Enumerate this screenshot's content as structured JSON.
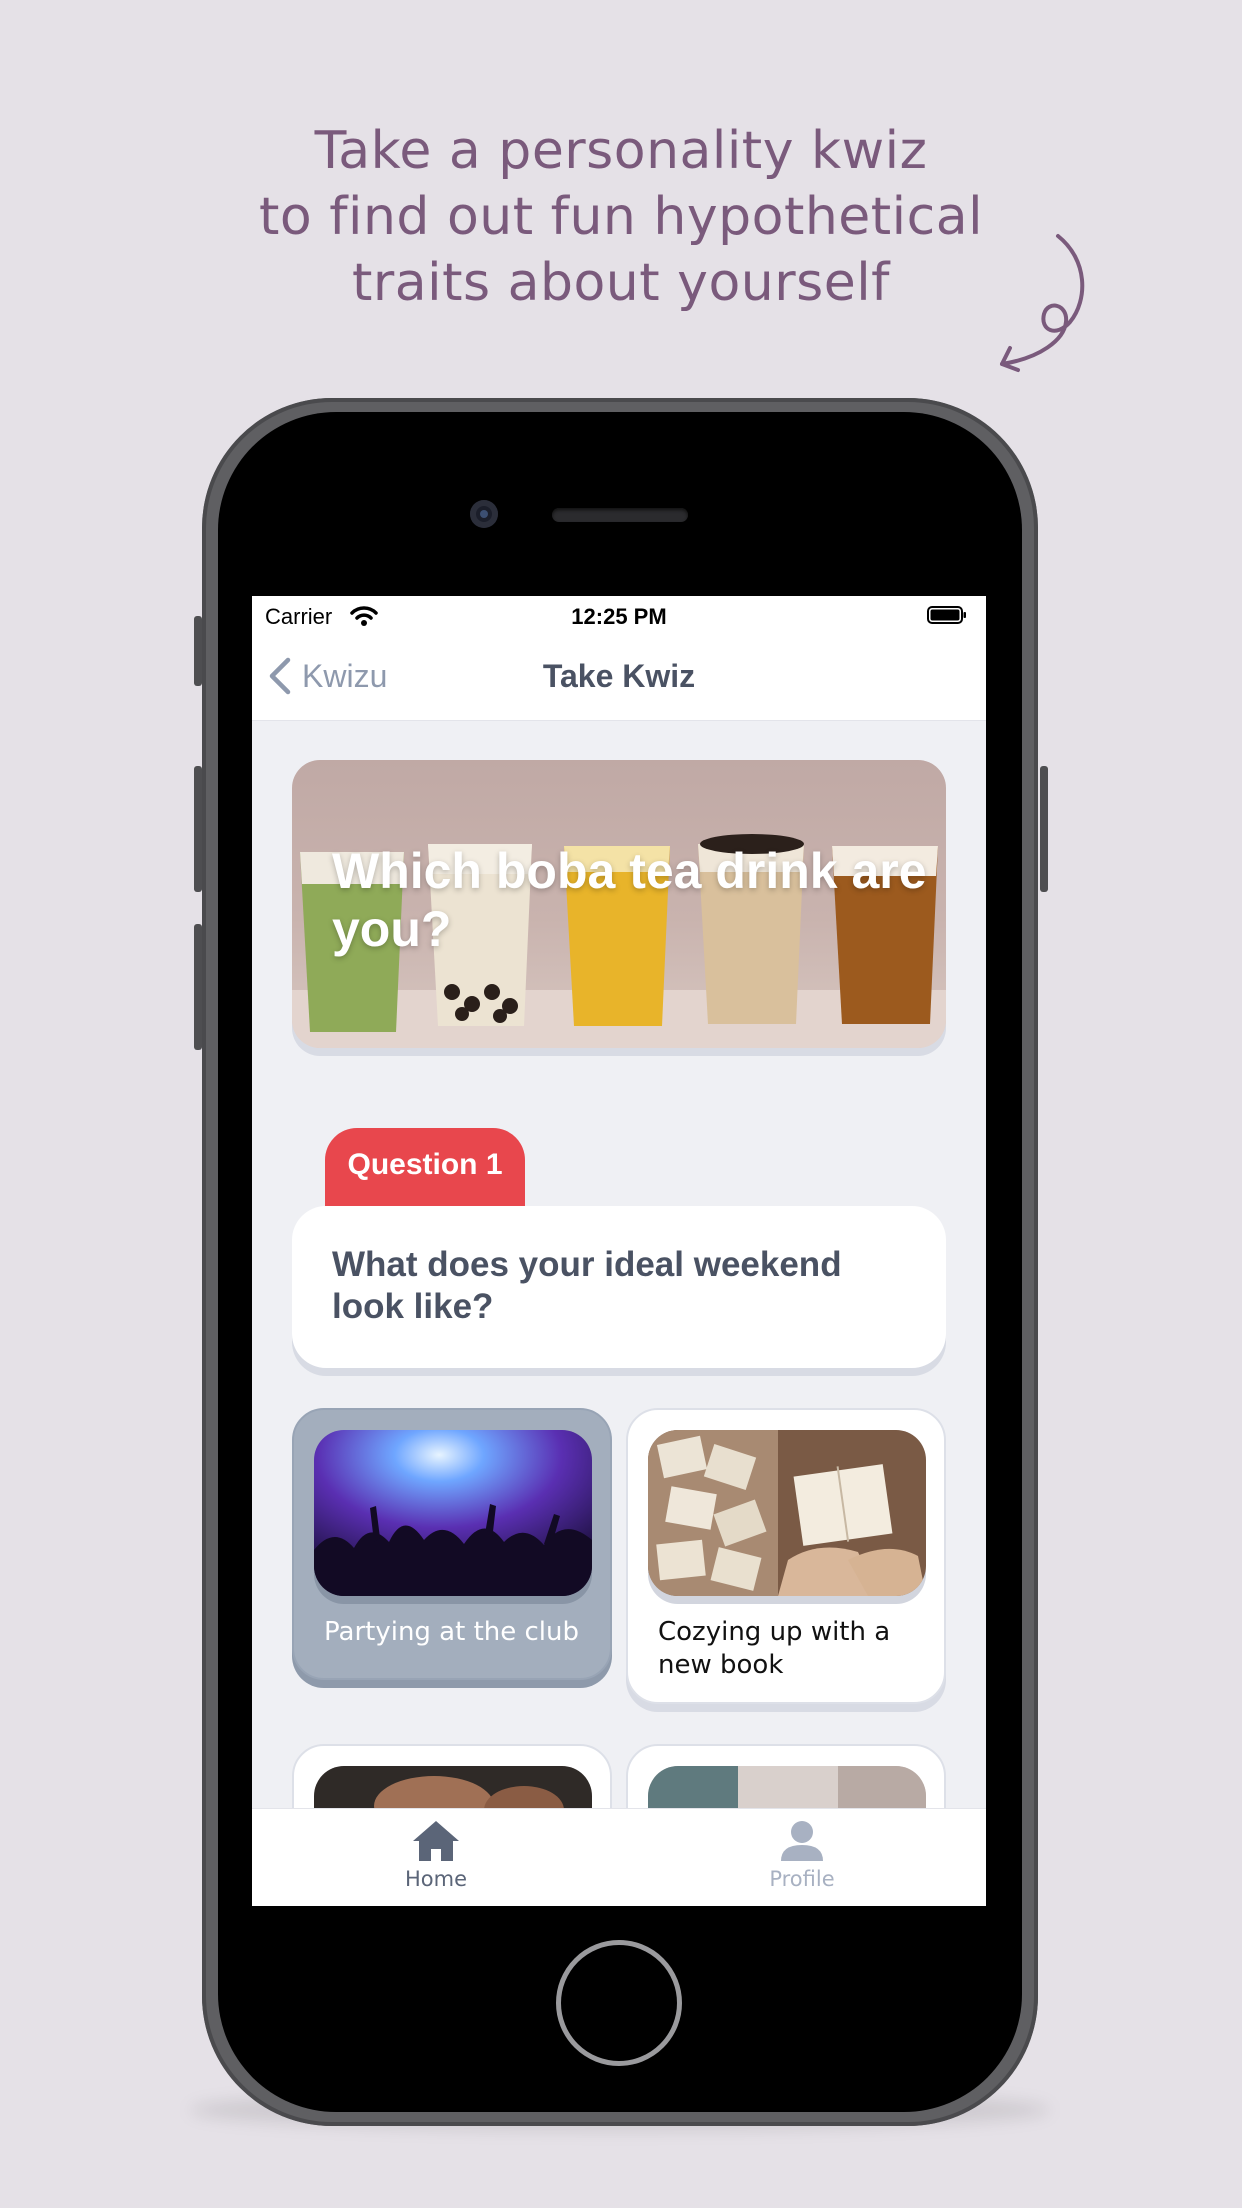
{
  "headline": {
    "line1": "Take a personality kwiz",
    "line2": "to find out fun hypothetical",
    "line3": "traits about yourself"
  },
  "status_bar": {
    "carrier": "Carrier",
    "time": "12:25 PM"
  },
  "nav": {
    "back_label": "Kwizu",
    "title": "Take Kwiz"
  },
  "quiz": {
    "title": "Which boba tea drink are you?"
  },
  "question": {
    "tab_label": "Question 1",
    "text": "What does your ideal weekend look like?"
  },
  "answers": [
    {
      "label": "Partying at the club",
      "selected": true
    },
    {
      "label": "Cozying up with a new book",
      "selected": false
    }
  ],
  "tabbar": {
    "home_label": "Home",
    "profile_label": "Profile",
    "active": "Home"
  },
  "colors": {
    "background": "#e5e1e7",
    "headline": "#7a5a7c",
    "question_tab": "#e8474d",
    "selected_answer": "#a3aebd",
    "title_text": "#4a5263"
  }
}
